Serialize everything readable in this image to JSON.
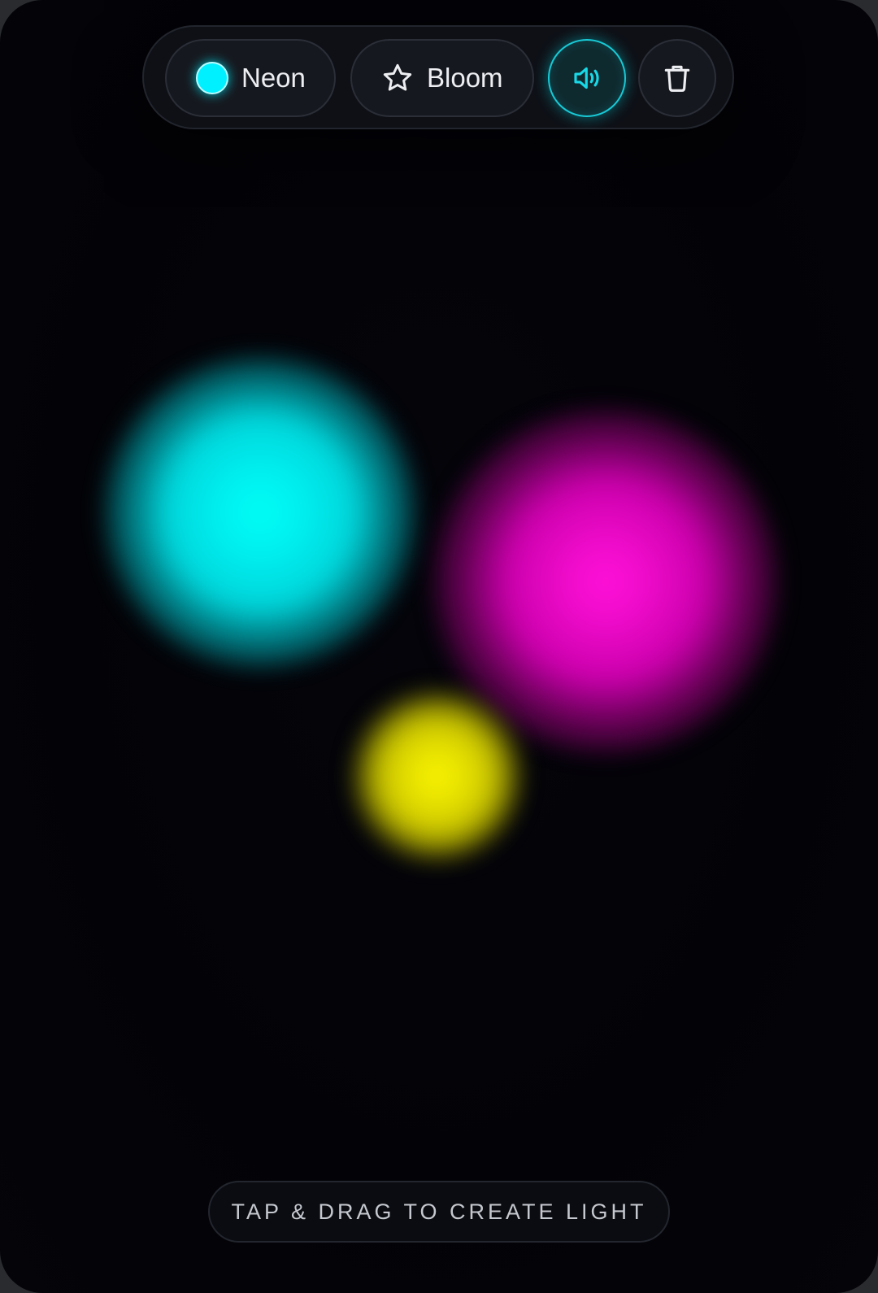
{
  "toolbar": {
    "palette_label": "Neon",
    "palette_color": "#00f0ff",
    "effect_label": "Bloom",
    "effect_icon": "star-icon",
    "sound_icon": "speaker-icon",
    "sound_active": true,
    "clear_icon": "trash-icon"
  },
  "lights": [
    {
      "color": "#00fff5",
      "name": "cyan"
    },
    {
      "color": "#ff10d8",
      "name": "magenta"
    },
    {
      "color": "#f5f000",
      "name": "yellow"
    }
  ],
  "hint": {
    "text": "TAP & DRAG TO CREATE LIGHT"
  },
  "colors": {
    "accent": "#00e5f0",
    "background": "#030307"
  }
}
